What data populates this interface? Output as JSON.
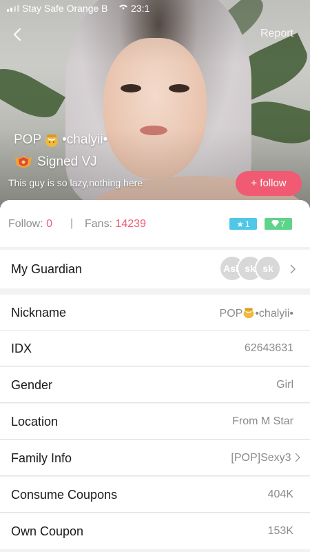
{
  "status_bar": {
    "carrier": "Stay Safe Orange B",
    "time": "23:1"
  },
  "header": {
    "report_label": "Report"
  },
  "profile": {
    "name_prefix": "POP",
    "name_suffix": "•chalyii•",
    "badge_text": "Signed VJ",
    "bio": "This guy is so lazy,nothing here",
    "follow_button": "+ follow"
  },
  "stats": {
    "follow_label": "Follow:",
    "follow_value": "0",
    "separator": "|",
    "fans_label": "Fans:",
    "fans_value": "14239",
    "star_level": "1",
    "gem_level": "7"
  },
  "guardian": {
    "label": "My Guardian",
    "avatars": [
      "Ask",
      "sk",
      "sk"
    ]
  },
  "info_rows": [
    {
      "label": "Nickname",
      "value_prefix": "POP",
      "value_suffix": "•chalyii•"
    },
    {
      "label": "IDX",
      "value": "62643631"
    },
    {
      "label": "Gender",
      "value": "Girl"
    },
    {
      "label": "Location",
      "value": "From M Star"
    },
    {
      "label": "Family Info",
      "value": "[POP]Sexy3"
    },
    {
      "label": "Consume Coupons",
      "value": "404K"
    },
    {
      "label": "Own Coupon",
      "value": "153K"
    }
  ],
  "colors": {
    "accent": "#f05a72",
    "star_chip": "#4fc7e6",
    "gem_chip": "#5ed38a"
  },
  "icons": [
    "back-chevron-icon",
    "wifi-icon",
    "honey-pot-icon",
    "signed-vj-badge-icon",
    "star-icon",
    "gem-icon",
    "chevron-right-icon"
  ]
}
